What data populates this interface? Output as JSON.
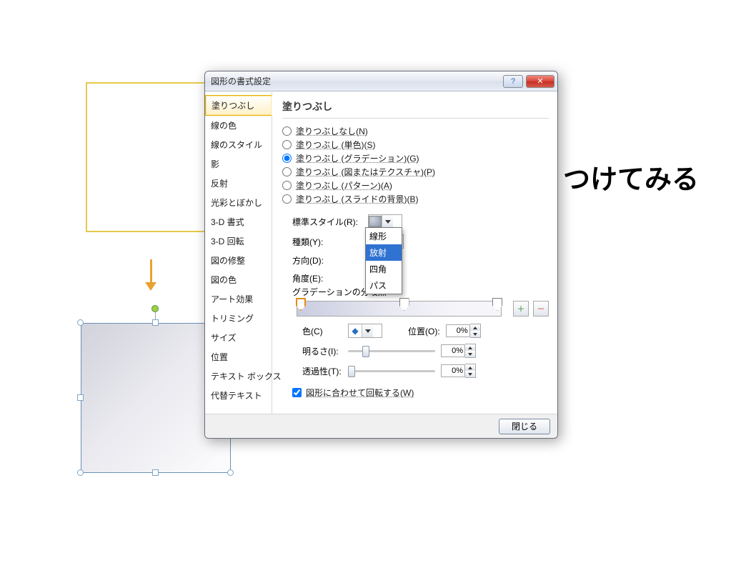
{
  "dialog": {
    "title": "図形の書式設定",
    "close_button": "閉じる"
  },
  "sidebar": {
    "items": [
      "塗りつぶし",
      "線の色",
      "線のスタイル",
      "影",
      "反射",
      "光彩とぼかし",
      "3-D 書式",
      "3-D 回転",
      "図の修整",
      "図の色",
      "アート効果",
      "トリミング",
      "サイズ",
      "位置",
      "テキスト ボックス",
      "代替テキスト"
    ],
    "active_index": 0
  },
  "panel": {
    "title": "塗りつぶし",
    "radios": [
      "塗りつぶしなし(N)",
      "塗りつぶし (単色)(S)",
      "塗りつぶし (グラデーション)(G)",
      "塗りつぶし (図またはテクスチャ)(P)",
      "塗りつぶし (パターン)(A)",
      "塗りつぶし (スライドの背景)(B)"
    ],
    "selected_radio": 2,
    "labels": {
      "preset": "標準スタイル(R):",
      "type": "種類(Y):",
      "direction": "方向(D):",
      "angle": "角度(E):",
      "stops": "グラデーションの分岐点",
      "color": "色(C)",
      "position": "位置(O):",
      "brightness": "明るさ(I):",
      "transparency": "透過性(T):",
      "rotate": "図形に合わせて回転する(W)"
    },
    "type_value": "放射",
    "type_options": [
      "線形",
      "放射",
      "四角",
      "パス"
    ],
    "type_selected_option": 1,
    "position_value": "0%",
    "brightness_value": "0%",
    "transparency_value": "0%",
    "rotate_checked": true,
    "grad_add_icon": "＋",
    "grad_remove_icon": "－"
  },
  "bg_text": "つけてみる"
}
